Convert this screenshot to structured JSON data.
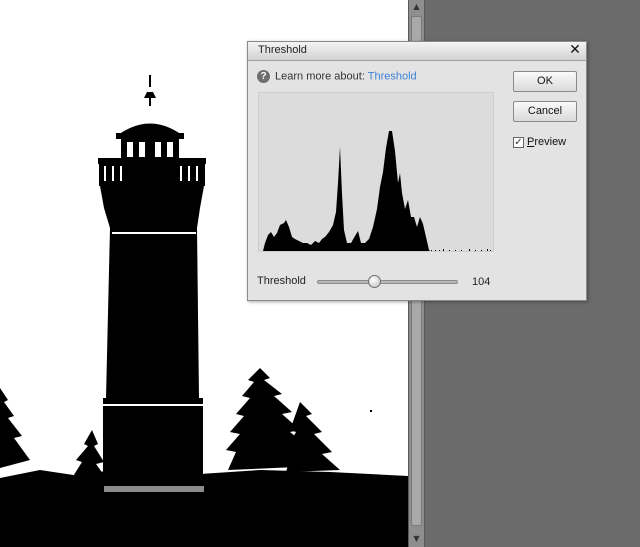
{
  "dialog": {
    "title": "Threshold",
    "close_icon": "✕",
    "help_icon": "?",
    "help_text": "Learn more about:",
    "help_link": "Threshold",
    "threshold_label": "Threshold",
    "threshold_value": "104",
    "threshold_level": 104,
    "threshold_max": 255,
    "ok_label": "OK",
    "cancel_label": "Cancel",
    "preview_mnemonic": "P",
    "preview_rest": "review",
    "preview_checked": true,
    "preview_check_glyph": "✓"
  },
  "scrollbar": {
    "up_arrow": "▲",
    "down_arrow": "▼"
  },
  "colors": {
    "link": "#3d83d8",
    "dialog_bg": "#e3e3e3",
    "workspace_bg": "#6b6b6b"
  }
}
